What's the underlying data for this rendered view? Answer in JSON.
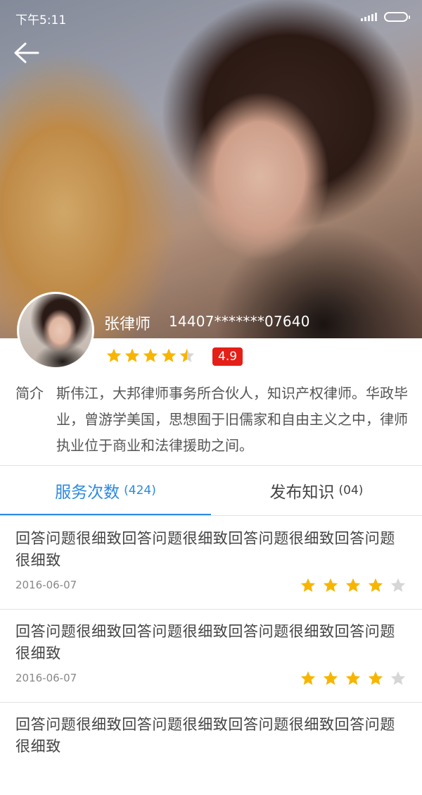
{
  "status_bar": {
    "time": "下午5:11"
  },
  "icons": {
    "back": "back-arrow-icon",
    "star": "star-icon",
    "signal": "signal-icon",
    "battery": "battery-icon"
  },
  "colors": {
    "accent": "#2c8ae0",
    "star": "#f7b500",
    "star_empty": "#d6d6d6",
    "badge": "#e41f17"
  },
  "lawyer": {
    "name": "张律师",
    "phone": "14407*******07640",
    "rating": 4.5,
    "rating_label": "4.9",
    "intro_label": "简介",
    "intro": "斯伟江，大邦律师事务所合伙人，知识产权律师。华政毕业，曾游学美国，思想囿于旧儒家和自由主义之中，律师执业位于商业和法律援助之间。"
  },
  "tabs": [
    {
      "label": "服务次数",
      "count": "(424)",
      "active": true
    },
    {
      "label": "发布知识",
      "count": "(04)",
      "active": false
    }
  ],
  "reviews": [
    {
      "text": "回答问题很细致回答问题很细致回答问题很细致回答问题很细致",
      "date": "2016-06-07",
      "stars": 4
    },
    {
      "text": "回答问题很细致回答问题很细致回答问题很细致回答问题很细致",
      "date": "2016-06-07",
      "stars": 4
    },
    {
      "text": "回答问题很细致回答问题很细致回答问题很细致回答问题很细致",
      "date": "",
      "stars": 0
    }
  ]
}
